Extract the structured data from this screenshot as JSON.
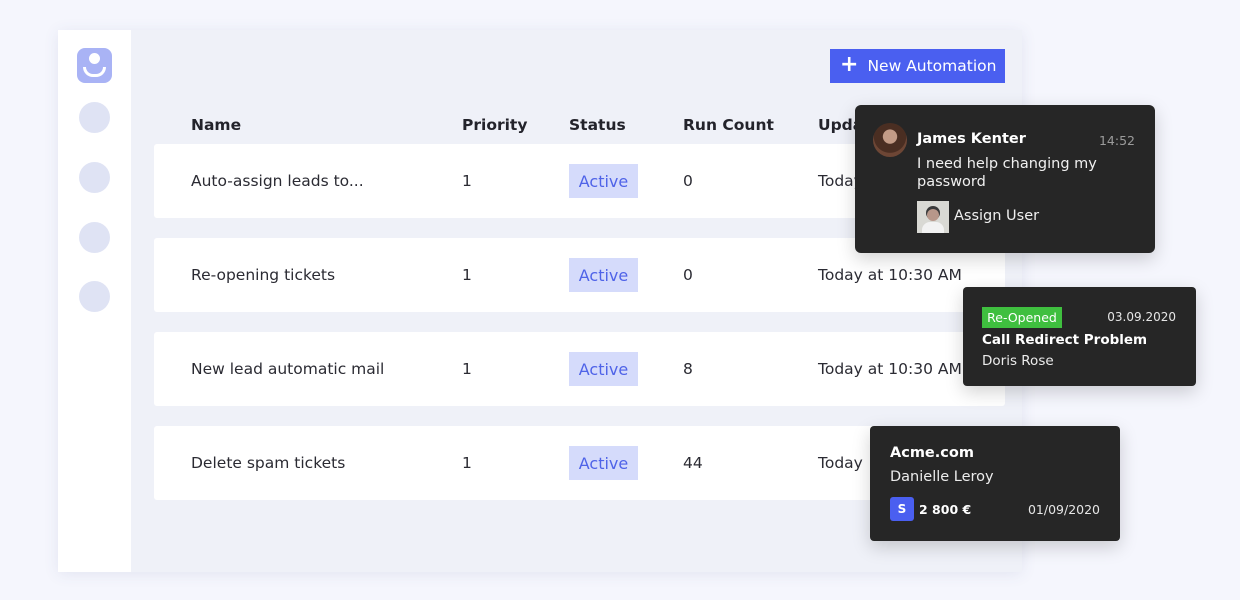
{
  "toolbar": {
    "new_automation_label": "New Automation",
    "plus_icon": "+"
  },
  "table": {
    "headers": [
      "Name",
      "Priority",
      "Status",
      "Run Count",
      "Upda"
    ],
    "rows": [
      {
        "name": "Auto-assign leads to...",
        "priority": "1",
        "status": "Active",
        "run_count": "0",
        "updated": "Today"
      },
      {
        "name": "Re-opening tickets",
        "priority": "1",
        "status": "Active",
        "run_count": "0",
        "updated": "Today at 10:30 AM"
      },
      {
        "name": "New lead automatic mail",
        "priority": "1",
        "status": "Active",
        "run_count": "8",
        "updated": "Today at 10:30 AM"
      },
      {
        "name": "Delete spam tickets",
        "priority": "1",
        "status": "Active",
        "run_count": "44",
        "updated": "Today"
      }
    ]
  },
  "chat_card": {
    "name": "James Kenter",
    "time": "14:52",
    "message": "I need help changing my password",
    "assign_label": "Assign User"
  },
  "ticket_card": {
    "status": "Re-Opened",
    "date": "03.09.2020",
    "title": "Call Redirect Problem",
    "person": "Doris Rose"
  },
  "deal_card": {
    "company": "Acme.com",
    "person": "Danielle Leroy",
    "icon_letter": "S",
    "amount": "2 800 €",
    "date": "01/09/2020"
  },
  "colors": {
    "accent": "#4a5ff0",
    "badge_bg": "#d5dbfb",
    "reopened_green": "#3fbf3f",
    "card_dark": "#262626"
  }
}
